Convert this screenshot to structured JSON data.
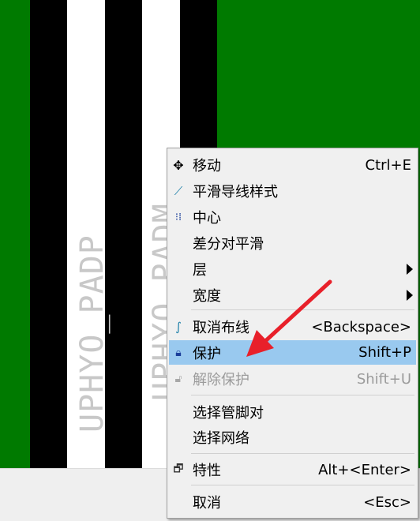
{
  "canvas": {
    "pad_labels": [
      "UPHYO_PADP",
      "UPHYO_PADM"
    ]
  },
  "menu": {
    "items": [
      {
        "icon": "move-icon",
        "label": "移动",
        "shortcut": "Ctrl+E"
      },
      {
        "icon": "smooth-trace-icon",
        "label": "平滑导线样式",
        "shortcut": ""
      },
      {
        "icon": "center-icon",
        "label": "中心",
        "shortcut": ""
      },
      {
        "icon": "",
        "label": "差分对平滑",
        "shortcut": ""
      },
      {
        "icon": "",
        "label": "层",
        "shortcut": "",
        "submenu": true
      },
      {
        "icon": "",
        "label": "宽度",
        "shortcut": "",
        "submenu": true
      },
      {
        "icon": "unroute-icon",
        "label": "取消布线",
        "shortcut": "<Backspace>"
      },
      {
        "icon": "lock-icon",
        "label": "保护",
        "shortcut": "Shift+P",
        "highlighted": true
      },
      {
        "icon": "unlock-icon",
        "label": "解除保护",
        "shortcut": "Shift+U",
        "disabled": true
      },
      {
        "icon": "",
        "label": "选择管脚对",
        "shortcut": ""
      },
      {
        "icon": "",
        "label": "选择网络",
        "shortcut": ""
      },
      {
        "icon": "properties-icon",
        "label": "特性",
        "shortcut": "Alt+<Enter>"
      },
      {
        "icon": "",
        "label": "取消",
        "shortcut": "<Esc>"
      }
    ]
  },
  "colors": {
    "pcb_background": "#007a00",
    "highlight": "#99c9ef",
    "annotation_arrow": "#e8202a"
  }
}
